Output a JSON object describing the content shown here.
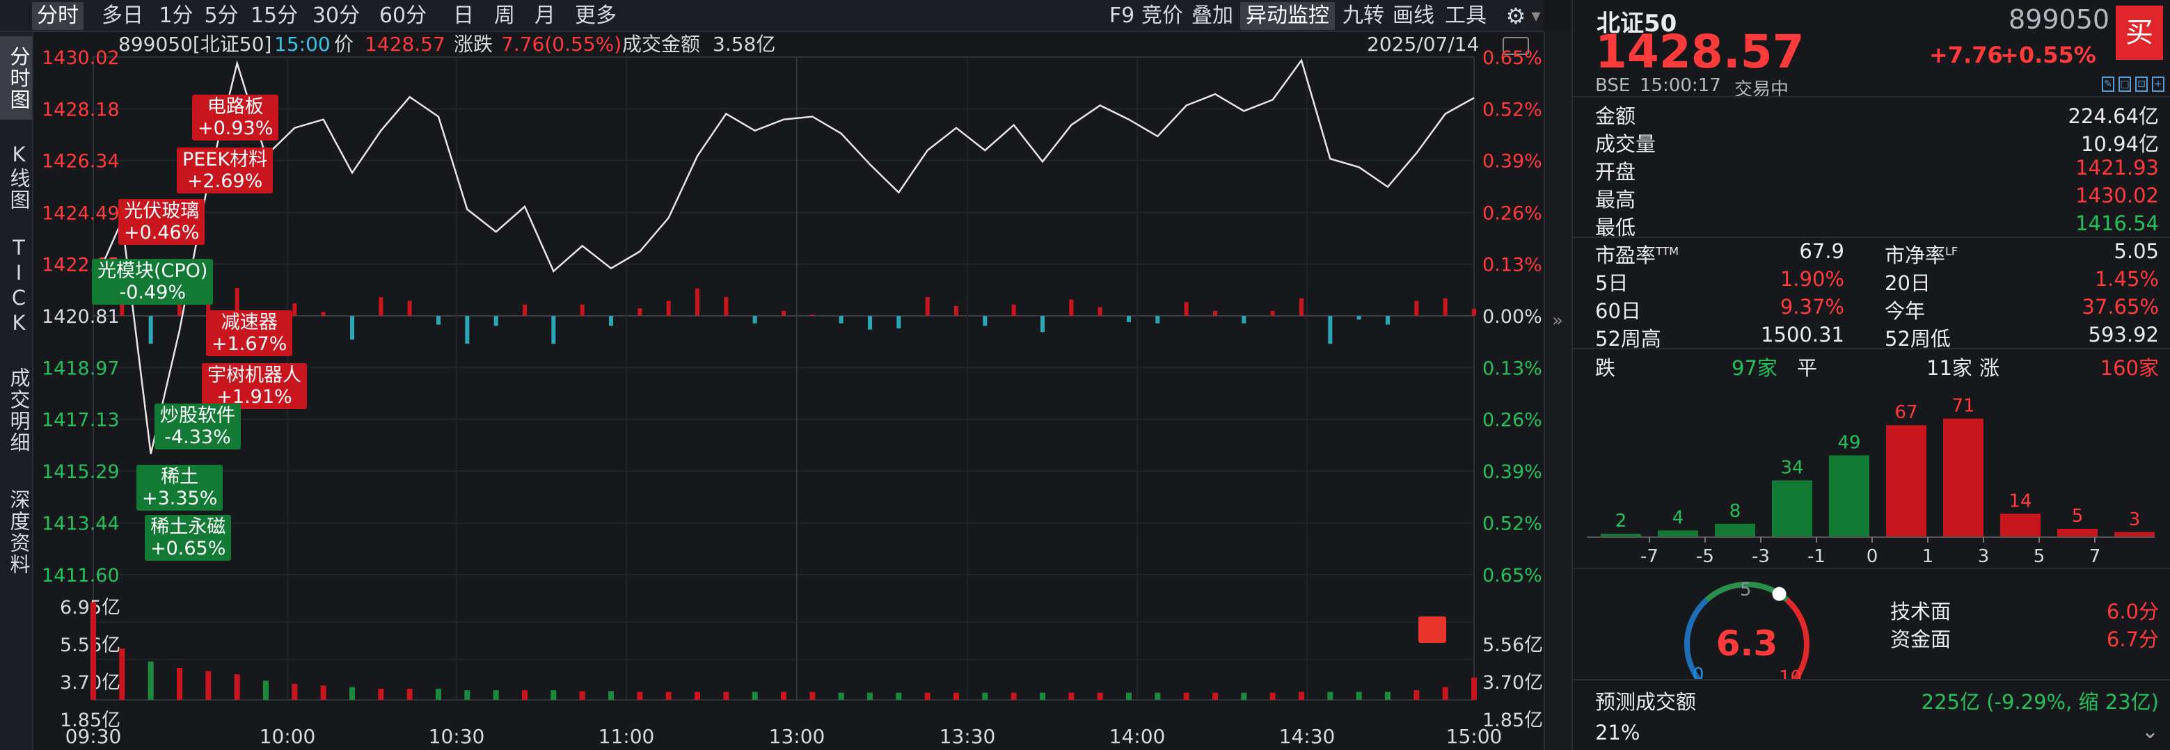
{
  "tabs": [
    "分时",
    "多日",
    "1分",
    "5分",
    "15分",
    "30分",
    "60分",
    "日",
    "周",
    "月",
    "更多"
  ],
  "right_tools": [
    "F9",
    "竞价",
    "叠加",
    "异动监控",
    "九转",
    "画线",
    "工具"
  ],
  "sidebar": [
    "分时图",
    "K线图",
    "TICK",
    "成交明细",
    "深度资料"
  ],
  "info_bar": {
    "code": "899050[北证50]",
    "time": "15:00",
    "price_label": "价",
    "price": "1428.57",
    "change_label": "涨跌",
    "change": "7.76(0.55%)",
    "amount_label": "成交金额",
    "amount": "3.58亿",
    "date": "2025/07/14"
  },
  "price_axis": [
    "1430.02",
    "1428.18",
    "1426.34",
    "1424.49",
    "1422.65",
    "1420.81",
    "1418.97",
    "1417.13",
    "1415.29",
    "1413.44",
    "1411.60"
  ],
  "pct_axis": [
    "0.65%",
    "0.52%",
    "0.39%",
    "0.26%",
    "0.13%",
    "0.00%",
    "0.13%",
    "0.26%",
    "0.39%",
    "0.52%",
    "0.65%"
  ],
  "vol_axis": [
    "6.95亿",
    "5.56亿",
    "3.70亿",
    "1.85亿"
  ],
  "vol_axis_right": [
    "5.56亿",
    "3.70亿",
    "1.85亿"
  ],
  "time_axis": [
    "09:30",
    "10:00",
    "10:30",
    "11:00",
    "13:00",
    "13:30",
    "14:00",
    "14:30",
    "15:00"
  ],
  "events": [
    {
      "name": "电路板",
      "chg": "+0.93%",
      "color": "red"
    },
    {
      "name": "PEEK材料",
      "chg": "+2.69%",
      "color": "red"
    },
    {
      "name": "光伏玻璃",
      "chg": "+0.46%",
      "color": "red"
    },
    {
      "name": "光模块(CPO)",
      "chg": "-0.49%",
      "color": "green"
    },
    {
      "name": "减速器",
      "chg": "+1.67%",
      "color": "red"
    },
    {
      "name": "宇树机器人",
      "chg": "+1.91%",
      "color": "red"
    },
    {
      "name": "炒股软件",
      "chg": "-4.33%",
      "color": "green"
    },
    {
      "name": "稀土",
      "chg": "+3.35%",
      "color": "green"
    },
    {
      "name": "稀土永磁",
      "chg": "+0.65%",
      "color": "green"
    }
  ],
  "quote": {
    "name": "北证50",
    "code": "899050",
    "price": "1428.57",
    "change": "+7.76",
    "change_pct": "+0.55%",
    "exchange": "BSE",
    "time": "15:00:17",
    "status": "交易中",
    "buy": "买"
  },
  "stats": [
    {
      "label": "金额",
      "value": "224.64亿",
      "color": "white"
    },
    {
      "label": "成交量",
      "value": "10.94亿",
      "color": "white"
    },
    {
      "label": "开盘",
      "value": "1421.93",
      "color": "red"
    },
    {
      "label": "最高",
      "value": "1430.02",
      "color": "red"
    },
    {
      "label": "最低",
      "value": "1416.54",
      "color": "green"
    }
  ],
  "ratios": [
    {
      "l1": "市盈率",
      "s1": "TTM",
      "v1": "67.9",
      "c1": "white",
      "l2": "市净率",
      "s2": "LF",
      "v2": "5.05",
      "c2": "white"
    },
    {
      "l1": "5日",
      "s1": "",
      "v1": "1.90%",
      "c1": "red",
      "l2": "20日",
      "s2": "",
      "v2": "1.45%",
      "c2": "red"
    },
    {
      "l1": "60日",
      "s1": "",
      "v1": "9.37%",
      "c1": "red",
      "l2": "今年",
      "s2": "",
      "v2": "37.65%",
      "c2": "red"
    },
    {
      "l1": "52周高",
      "s1": "",
      "v1": "1500.31",
      "c1": "white",
      "l2": "52周低",
      "s2": "",
      "v2": "593.92",
      "c2": "white"
    }
  ],
  "breadth": {
    "down_label": "跌",
    "down": "97家",
    "flat_label": "平",
    "flat": "11家",
    "up_label": "涨",
    "up": "160家"
  },
  "distribution": {
    "bars": [
      2,
      4,
      8,
      34,
      49,
      67,
      71,
      14,
      5,
      3
    ],
    "bar_colors": [
      "green",
      "green",
      "green",
      "green",
      "green",
      "red",
      "red",
      "red",
      "red",
      "red"
    ],
    "ticks": [
      "-7",
      "-5",
      "-3",
      "-1",
      "0",
      "1",
      "3",
      "5",
      "7"
    ]
  },
  "score": {
    "value": "6.3",
    "min": "0",
    "mid": "5",
    "max": "10",
    "tech_label": "技术面",
    "tech": "6.0分",
    "fund_label": "资金面",
    "fund": "6.7分"
  },
  "forecast": {
    "label": "预测成交额",
    "value": "225亿 (-9.29%, 缩 23亿)",
    "pct": "21%"
  },
  "chart_data": {
    "type": "line",
    "ylim": [
      1411.6,
      1430.02
    ],
    "prev_close": 1420.81,
    "x": [
      "09:30",
      "09:35",
      "09:40",
      "09:45",
      "09:50",
      "09:55",
      "10:00",
      "10:05",
      "10:10",
      "10:15",
      "10:20",
      "10:25",
      "10:30",
      "10:35",
      "10:40",
      "10:45",
      "10:50",
      "10:55",
      "11:00",
      "11:05",
      "11:10",
      "11:15",
      "11:20",
      "11:25",
      "11:30",
      "13:05",
      "13:10",
      "13:15",
      "13:20",
      "13:25",
      "13:30",
      "13:35",
      "13:40",
      "13:45",
      "13:50",
      "13:55",
      "14:00",
      "14:05",
      "14:10",
      "14:15",
      "14:20",
      "14:25",
      "14:30",
      "14:35",
      "14:40",
      "14:45",
      "14:50",
      "14:55",
      "15:00"
    ],
    "price": [
      1421.9,
      1424.2,
      1415.9,
      1420.3,
      1425.6,
      1429.8,
      1426.5,
      1427.5,
      1427.8,
      1425.9,
      1427.4,
      1428.6,
      1427.9,
      1424.6,
      1423.8,
      1424.7,
      1422.4,
      1423.3,
      1422.5,
      1423.1,
      1424.3,
      1426.5,
      1428.0,
      1427.4,
      1427.8,
      1427.9,
      1427.3,
      1426.2,
      1425.2,
      1426.7,
      1427.5,
      1426.7,
      1427.6,
      1426.3,
      1427.6,
      1428.3,
      1427.8,
      1427.2,
      1428.3,
      1428.7,
      1428.1,
      1428.5,
      1429.9,
      1426.4,
      1426.1,
      1425.4,
      1426.6,
      1428.0,
      1428.57
    ],
    "volume_unit": "亿",
    "volume": [
      6.1,
      3.2,
      2.4,
      2.0,
      1.8,
      1.6,
      1.2,
      1.0,
      0.9,
      0.8,
      0.7,
      0.7,
      0.7,
      0.6,
      0.6,
      0.6,
      0.6,
      0.55,
      0.55,
      0.5,
      0.5,
      0.5,
      0.5,
      0.5,
      0.5,
      0.5,
      0.45,
      0.45,
      0.45,
      0.45,
      0.45,
      0.45,
      0.45,
      0.45,
      0.45,
      0.45,
      0.45,
      0.45,
      0.45,
      0.45,
      0.45,
      0.45,
      0.5,
      0.5,
      0.5,
      0.5,
      0.6,
      0.8,
      1.4
    ]
  }
}
